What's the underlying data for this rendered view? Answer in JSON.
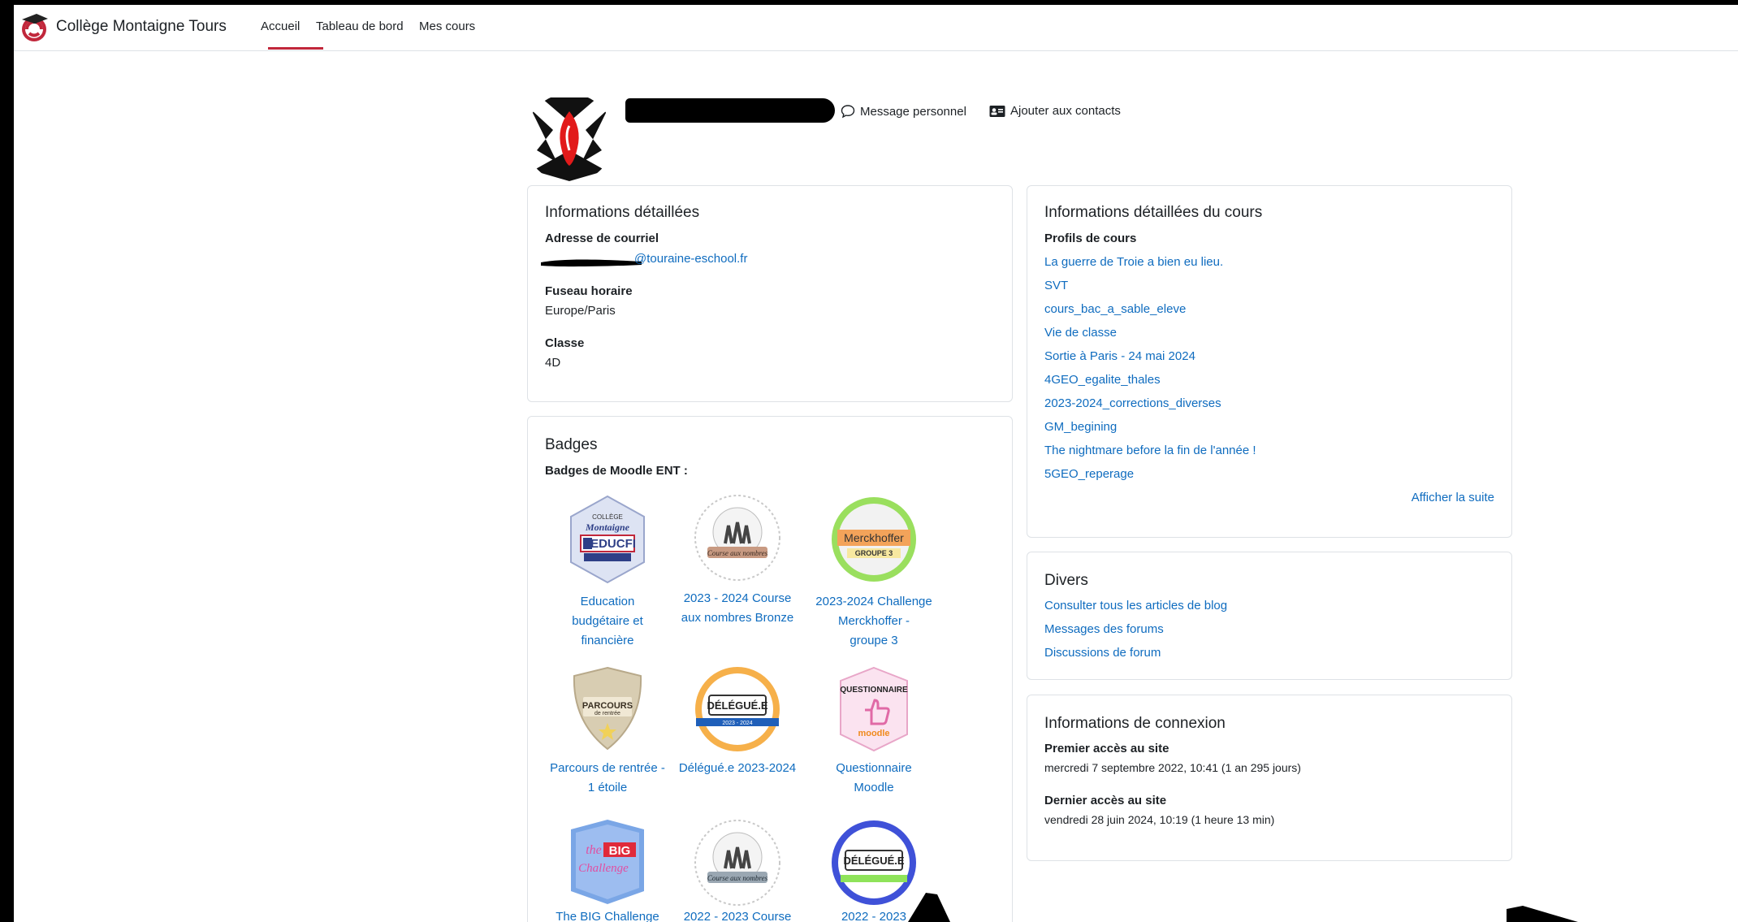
{
  "nav": {
    "site_name": "Collège Montaigne Tours",
    "links": [
      "Accueil",
      "Tableau de bord",
      "Mes cours"
    ]
  },
  "header": {
    "message_label": "Message personnel",
    "contacts_label": "Ajouter aux contacts"
  },
  "details": {
    "title": "Informations détaillées",
    "email_label": "Adresse de courriel",
    "email_value": "@touraine-eschool.fr",
    "tz_label": "Fuseau horaire",
    "tz_value": "Europe/Paris",
    "class_label": "Classe",
    "class_value": "4D"
  },
  "badges": {
    "title": "Badges",
    "subtitle": "Badges de Moodle ENT :",
    "items": [
      {
        "name_lines": [
          "Education",
          "budgétaire et",
          "financière"
        ]
      },
      {
        "name_lines": [
          "2023 - 2024 Course",
          "aux nombres Bronze"
        ]
      },
      {
        "name_lines": [
          "2023-2024 Challenge",
          "Merckhoffer -",
          "groupe 3"
        ]
      },
      {
        "name_lines": [
          "Parcours de rentrée -",
          "1 étoile"
        ]
      },
      {
        "name_lines": [
          "Délégué.e 2023-2024"
        ]
      },
      {
        "name_lines": [
          "Questionnaire",
          "Moodle"
        ]
      },
      {
        "name_lines": [
          "The BIG Challenge"
        ]
      },
      {
        "name_lines": [
          "2022 - 2023 Course"
        ]
      },
      {
        "name_lines": [
          "2022 - 2023"
        ]
      }
    ],
    "art": {
      "educ_college": "COLLÈGE",
      "educ_montaigne": "Montaigne",
      "educ_educfi": "EDUCFI",
      "course_label": "Course aux nombres",
      "merck_name": "Merckhoffer",
      "merck_group": "GROUPE 3",
      "parcours": "PARCOURS",
      "parcours_sub": "de rentrée",
      "delegue": "DÉLÉGUÉ.E",
      "delegue_year": "2023 - 2024",
      "quest": "QUESTIONNAIRE",
      "quest_moodle": "moodle",
      "big_the": "the",
      "big_big": "BIG",
      "big_challenge": "Challenge"
    }
  },
  "course": {
    "title": "Informations détaillées du cours",
    "profiles_label": "Profils de cours",
    "courses": [
      "La guerre de Troie a bien eu lieu.",
      "SVT",
      "cours_bac_a_sable_eleve",
      "Vie de classe",
      "Sortie à Paris - 24 mai 2024",
      "4GEO_egalite_thales",
      "2023-2024_corrections_diverses",
      "GM_begining",
      "The nightmare before la fin de l'année !",
      "5GEO_reperage"
    ],
    "more_label": "Afficher la suite"
  },
  "misc": {
    "title": "Divers",
    "links": [
      "Consulter tous les articles de blog",
      "Messages des forums",
      "Discussions de forum"
    ]
  },
  "login": {
    "title": "Informations de connexion",
    "first_label": "Premier accès au site",
    "first_value": "mercredi 7 septembre 2022, 10:41  (1 an 295 jours)",
    "last_label": "Dernier accès au site",
    "last_value": "vendredi 28 juin 2024, 10:19  (1 heure 13 min)"
  },
  "colors": {
    "link": "#0f6cbf",
    "brand_red": "#c1273b",
    "text": "#1d2125"
  }
}
